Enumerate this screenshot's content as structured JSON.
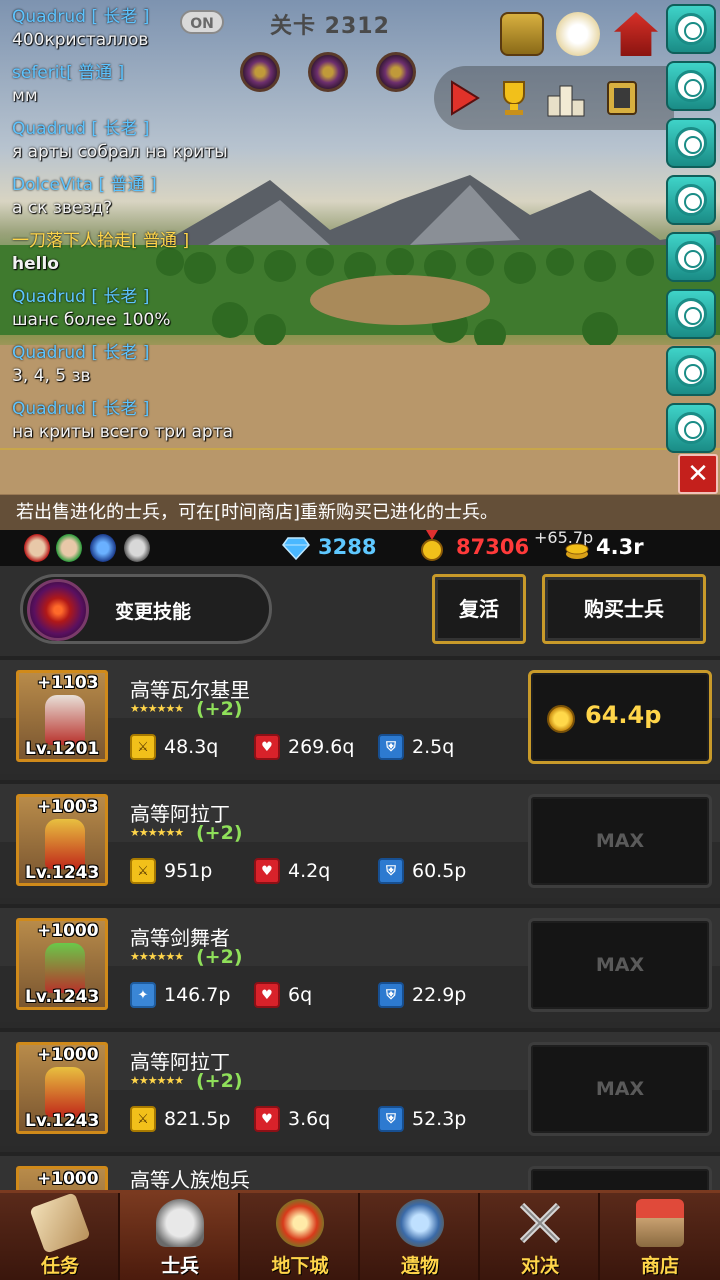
{
  "hud": {
    "stage": "关卡 2312",
    "chat_toggle": "ON"
  },
  "chat": [
    {
      "name": "Quadrud",
      "rank": "[ 长老 ]",
      "message": "400кристаллов",
      "name_color": "blue",
      "bold": false
    },
    {
      "name": "seferit",
      "rank": "[ 普通 ]",
      "message": "мм",
      "name_color": "blue",
      "bold": false
    },
    {
      "name": "Quadrud",
      "rank": "[ 长老 ]",
      "message": "я арты собрал на криты",
      "name_color": "blue",
      "bold": false
    },
    {
      "name": "DolceVita",
      "rank": "[ 普通 ]",
      "message": "а ск звезд?",
      "name_color": "blue",
      "bold": false
    },
    {
      "name": "一刀落下人拾走",
      "rank": "[ 普通 ]",
      "message": "hello",
      "name_color": "gold",
      "bold": true
    },
    {
      "name": "Quadrud",
      "rank": "[ 长老 ]",
      "message": "шанс  более 100%",
      "name_color": "blue",
      "bold": false
    },
    {
      "name": "Quadrud",
      "rank": "[ 长老 ]",
      "message": "3, 4, 5 зв",
      "name_color": "blue",
      "bold": false
    },
    {
      "name": "Quadrud",
      "rank": "[ 长老 ]",
      "message": "на криты всего три арта",
      "name_color": "blue",
      "bold": false
    }
  ],
  "close_label": "✕",
  "notice": "若出售进化的士兵，可在[时间商店]重新购买已进化的士兵。",
  "currency": {
    "gems": "3288",
    "gold": "87306",
    "rate_plus": "+65.7p",
    "rate": "4.3r"
  },
  "actions": {
    "change_skill": "变更技能",
    "revive": "复活",
    "buy_soldier": "购买士兵"
  },
  "units": [
    {
      "name": "高等瓦尔基里",
      "plus": "+1103",
      "level": "Lv.1201",
      "stars": "★★★★★★",
      "bonus": "(+2)",
      "atk_type": "sword",
      "atk": "48.3q",
      "hp": "269.6q",
      "def": "2.5q",
      "upgrade": "64.4p",
      "maxed": false
    },
    {
      "name": "高等阿拉丁",
      "plus": "+1003",
      "level": "Lv.1243",
      "stars": "★★★★★★",
      "bonus": "(+2)",
      "atk_type": "sword",
      "atk": "951p",
      "hp": "4.2q",
      "def": "60.5p",
      "upgrade": "MAX",
      "maxed": true
    },
    {
      "name": "高等剑舞者",
      "plus": "+1000",
      "level": "Lv.1243",
      "stars": "★★★★★★",
      "bonus": "(+2)",
      "atk_type": "magic",
      "atk": "146.7p",
      "hp": "6q",
      "def": "22.9p",
      "upgrade": "MAX",
      "maxed": true
    },
    {
      "name": "高等阿拉丁",
      "plus": "+1000",
      "level": "Lv.1243",
      "stars": "★★★★★★",
      "bonus": "(+2)",
      "atk_type": "sword",
      "atk": "821.5p",
      "hp": "3.6q",
      "def": "52.3p",
      "upgrade": "MAX",
      "maxed": true
    },
    {
      "name": "高等人族炮兵",
      "plus": "+1000",
      "level": "",
      "stars": "",
      "bonus": "",
      "atk_type": "sword",
      "atk": "",
      "hp": "",
      "def": "",
      "upgrade": "",
      "maxed": true
    }
  ],
  "nav": [
    {
      "label": "任务",
      "icon": "scroll-icon",
      "active": false
    },
    {
      "label": "士兵",
      "icon": "helmet-icon",
      "active": true
    },
    {
      "label": "地下城",
      "icon": "monster-icon",
      "active": false
    },
    {
      "label": "遗物",
      "icon": "orb-icon",
      "active": false
    },
    {
      "label": "对决",
      "icon": "crossed-swords-icon",
      "active": false
    },
    {
      "label": "商店",
      "icon": "shop-icon",
      "active": false
    }
  ],
  "colors": {
    "gold_text": "#ffd54a",
    "gem_text": "#5fc8ff",
    "gold_amount": "#ff3a3a",
    "bonus_green": "#8fe05a",
    "chat_name_blue": "#5dc4ff"
  }
}
